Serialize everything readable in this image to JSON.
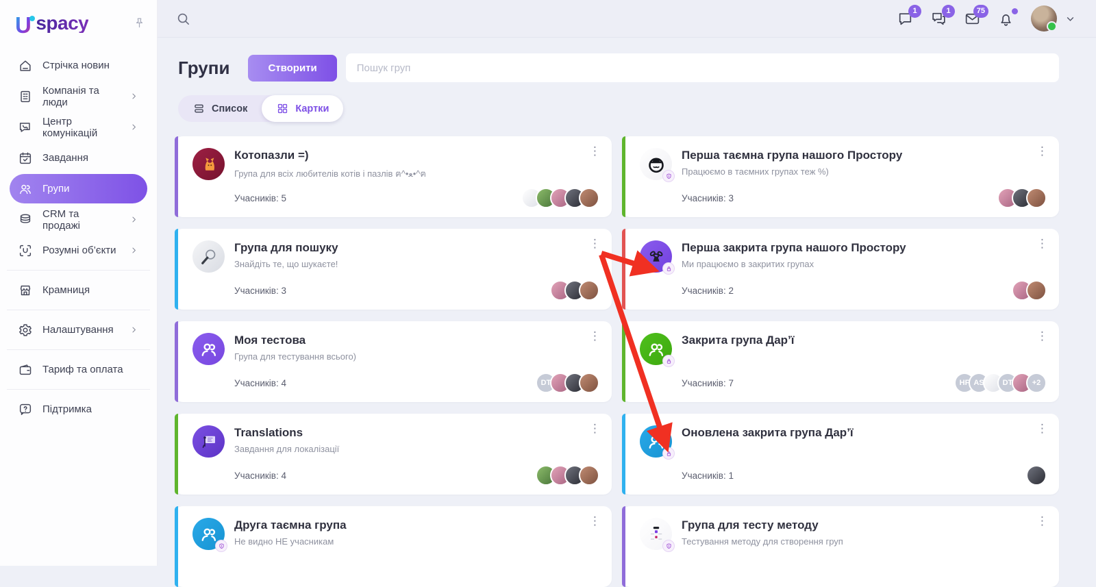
{
  "brand": {
    "u": "U",
    "rest": "spacy"
  },
  "sidebar": {
    "items": [
      {
        "id": "feed",
        "label": "Стрічка новин",
        "icon": "home-icon",
        "chevron": false
      },
      {
        "id": "company",
        "label": "Компанія та люди",
        "icon": "company-icon",
        "chevron": true
      },
      {
        "id": "communications",
        "label": "Центр комунікацій",
        "icon": "communications-icon",
        "chevron": true
      },
      {
        "id": "tasks",
        "label": "Завдання",
        "icon": "tasks-icon",
        "chevron": false
      },
      {
        "id": "groups",
        "label": "Групи",
        "icon": "groups-icon",
        "chevron": false,
        "active": true
      },
      {
        "id": "crm",
        "label": "CRM та продажі",
        "icon": "crm-icon",
        "chevron": true
      },
      {
        "id": "smart-objects",
        "label": "Розумні об’єкти",
        "icon": "smart-objects-icon",
        "chevron": true,
        "divider_after": true
      },
      {
        "id": "shop",
        "label": "Крамниця",
        "icon": "shop-icon",
        "chevron": false,
        "divider_after": true
      },
      {
        "id": "settings",
        "label": "Налаштування",
        "icon": "settings-icon",
        "chevron": true,
        "divider_after": true
      },
      {
        "id": "billing",
        "label": "Тариф та оплата",
        "icon": "billing-icon",
        "chevron": false,
        "divider_after": true
      },
      {
        "id": "support",
        "label": "Підтримка",
        "icon": "support-icon",
        "chevron": false
      }
    ]
  },
  "topbar": {
    "actions": [
      {
        "id": "chat",
        "icon": "chat-icon",
        "badge": "1"
      },
      {
        "id": "group-chat",
        "icon": "group-chat-icon",
        "badge": "1"
      },
      {
        "id": "mail",
        "icon": "mail-icon",
        "badge": "75"
      },
      {
        "id": "notifications",
        "icon": "bell-icon",
        "dot": true
      }
    ]
  },
  "header": {
    "title": "Групи",
    "create_button": "Створити",
    "search_placeholder": "Пошук груп"
  },
  "tabs": {
    "list": "Список",
    "cards": "Картки"
  },
  "accent_colors": {
    "purple": "#8f6cd9",
    "cyan": "#2fb1ef",
    "green": "#5fb52d",
    "red": "#e25352"
  },
  "columns": [
    [
      {
        "title": "Котопазли =)",
        "description": "Група для всіх любителів котів і пазлів ฅ^•ﻌ•^ฅ",
        "members_label": "Учасників: 5",
        "accent": "#8f6cd9",
        "avatar": {
          "kind": "cat",
          "bg": [
            "#9e2044",
            "#76122e"
          ],
          "badge": null
        },
        "members": [
          {
            "kind": "photo",
            "c": [
              "#ffffff",
              "#dfe1e8"
            ]
          },
          {
            "kind": "photo",
            "c": [
              "#8cbb6a",
              "#49763a"
            ]
          },
          {
            "kind": "photo",
            "c": [
              "#e2a3b8",
              "#a96583"
            ]
          },
          {
            "kind": "photo",
            "c": [
              "#70737e",
              "#2c2d35"
            ]
          },
          {
            "kind": "photo",
            "c": [
              "#c08b72",
              "#7e5240"
            ]
          }
        ]
      },
      {
        "title": "Група для пошуку",
        "description": "Знайдіть те, що шукаєте!",
        "members_label": "Учасників: 3",
        "accent": "#2fb1ef",
        "avatar": {
          "kind": "magnifier",
          "bg": [
            "#f4f5f7",
            "#d9dce3"
          ],
          "badge": null
        },
        "members": [
          {
            "kind": "photo",
            "c": [
              "#e2a3b8",
              "#a96583"
            ]
          },
          {
            "kind": "photo",
            "c": [
              "#70737e",
              "#2c2d35"
            ]
          },
          {
            "kind": "photo",
            "c": [
              "#c08b72",
              "#7e5240"
            ]
          }
        ]
      },
      {
        "title": "Моя тестова",
        "description": "Група для тестування всього)",
        "members_label": "Учасників: 4",
        "accent": "#8f6cd9",
        "avatar": {
          "kind": "people",
          "bg": [
            "#8a5ced",
            "#7747e0"
          ],
          "badge": null
        },
        "members": [
          {
            "kind": "initials",
            "text": "DT"
          },
          {
            "kind": "photo",
            "c": [
              "#e2a3b8",
              "#a96583"
            ]
          },
          {
            "kind": "photo",
            "c": [
              "#70737e",
              "#2c2d35"
            ]
          },
          {
            "kind": "photo",
            "c": [
              "#c08b72",
              "#7e5240"
            ]
          }
        ]
      },
      {
        "title": "Translations",
        "description": "Завдання для локалізації",
        "members_label": "Учасників: 4",
        "accent": "#5fb52d",
        "avatar": {
          "kind": "translations",
          "bg": [
            "#7b50e2",
            "#5c33c6"
          ],
          "badge": null
        },
        "members": [
          {
            "kind": "photo",
            "c": [
              "#8cbb6a",
              "#49763a"
            ]
          },
          {
            "kind": "photo",
            "c": [
              "#e2a3b8",
              "#a96583"
            ]
          },
          {
            "kind": "photo",
            "c": [
              "#70737e",
              "#2c2d35"
            ]
          },
          {
            "kind": "photo",
            "c": [
              "#c08b72",
              "#7e5240"
            ]
          }
        ]
      },
      {
        "title": "Друга таємна група",
        "description": "Не видно НЕ учасникам",
        "members_label": null,
        "accent": "#2fb1ef",
        "avatar": {
          "kind": "people",
          "bg": [
            "#2aa9e8",
            "#1693d2"
          ],
          "badge": "secret"
        },
        "members": []
      }
    ],
    [
      {
        "title": "Перша таємна група нашого Простору",
        "description": "Працюємо в таємних групах теж %)",
        "members_label": "Учасників: 3",
        "accent": "#5fb52d",
        "avatar": {
          "kind": "spy",
          "bg": [
            "#ffffff",
            "#f0f0f4"
          ],
          "badge": "secret"
        },
        "members": [
          {
            "kind": "photo",
            "c": [
              "#e2a3b8",
              "#a96583"
            ]
          },
          {
            "kind": "photo",
            "c": [
              "#70737e",
              "#2c2d35"
            ]
          },
          {
            "kind": "photo",
            "c": [
              "#c08b72",
              "#7e5240"
            ]
          }
        ]
      },
      {
        "title": "Перша закрита група нашого Простору",
        "description": "Ми працюємо в закритих групах",
        "members_label": "Учасників: 2",
        "accent": "#e25352",
        "avatar": {
          "kind": "chains",
          "bg": [
            "#8a5ced",
            "#7240de"
          ],
          "badge": "lock"
        },
        "members": [
          {
            "kind": "photo",
            "c": [
              "#e2a3b8",
              "#a96583"
            ]
          },
          {
            "kind": "photo",
            "c": [
              "#c08b72",
              "#7e5240"
            ]
          }
        ]
      },
      {
        "title": "Закрита група Дар’ї",
        "description": "",
        "members_label": "Учасників: 7",
        "accent": "#5fb52d",
        "avatar": {
          "kind": "people",
          "bg": [
            "#4fc01c",
            "#3da80f"
          ],
          "badge": "lock"
        },
        "members": [
          {
            "kind": "initials",
            "text": "HF"
          },
          {
            "kind": "initials",
            "text": "AS"
          },
          {
            "kind": "photo",
            "c": [
              "#ffffff",
              "#dfe1e8"
            ]
          },
          {
            "kind": "initials",
            "text": "DT"
          },
          {
            "kind": "photo",
            "c": [
              "#e2a3b8",
              "#a96583"
            ]
          },
          {
            "kind": "more",
            "text": "+2"
          }
        ]
      },
      {
        "title": "Оновлена закрита група Дар’ї",
        "description": "",
        "members_label": "Учасників: 1",
        "accent": "#2fb1ef",
        "avatar": {
          "kind": "people",
          "bg": [
            "#2aa9e8",
            "#1693d2"
          ],
          "badge": "lock"
        },
        "members": [
          {
            "kind": "photo",
            "c": [
              "#70737e",
              "#2c2d35"
            ]
          }
        ]
      },
      {
        "title": "Група для тесту методу",
        "description": "Тестування методу для створення груп",
        "members_label": null,
        "accent": "#8f6cd9",
        "avatar": {
          "kind": "screenshot",
          "bg": [
            "#ffffff",
            "#f4f4f8"
          ],
          "badge": "secret"
        },
        "members": []
      }
    ]
  ]
}
